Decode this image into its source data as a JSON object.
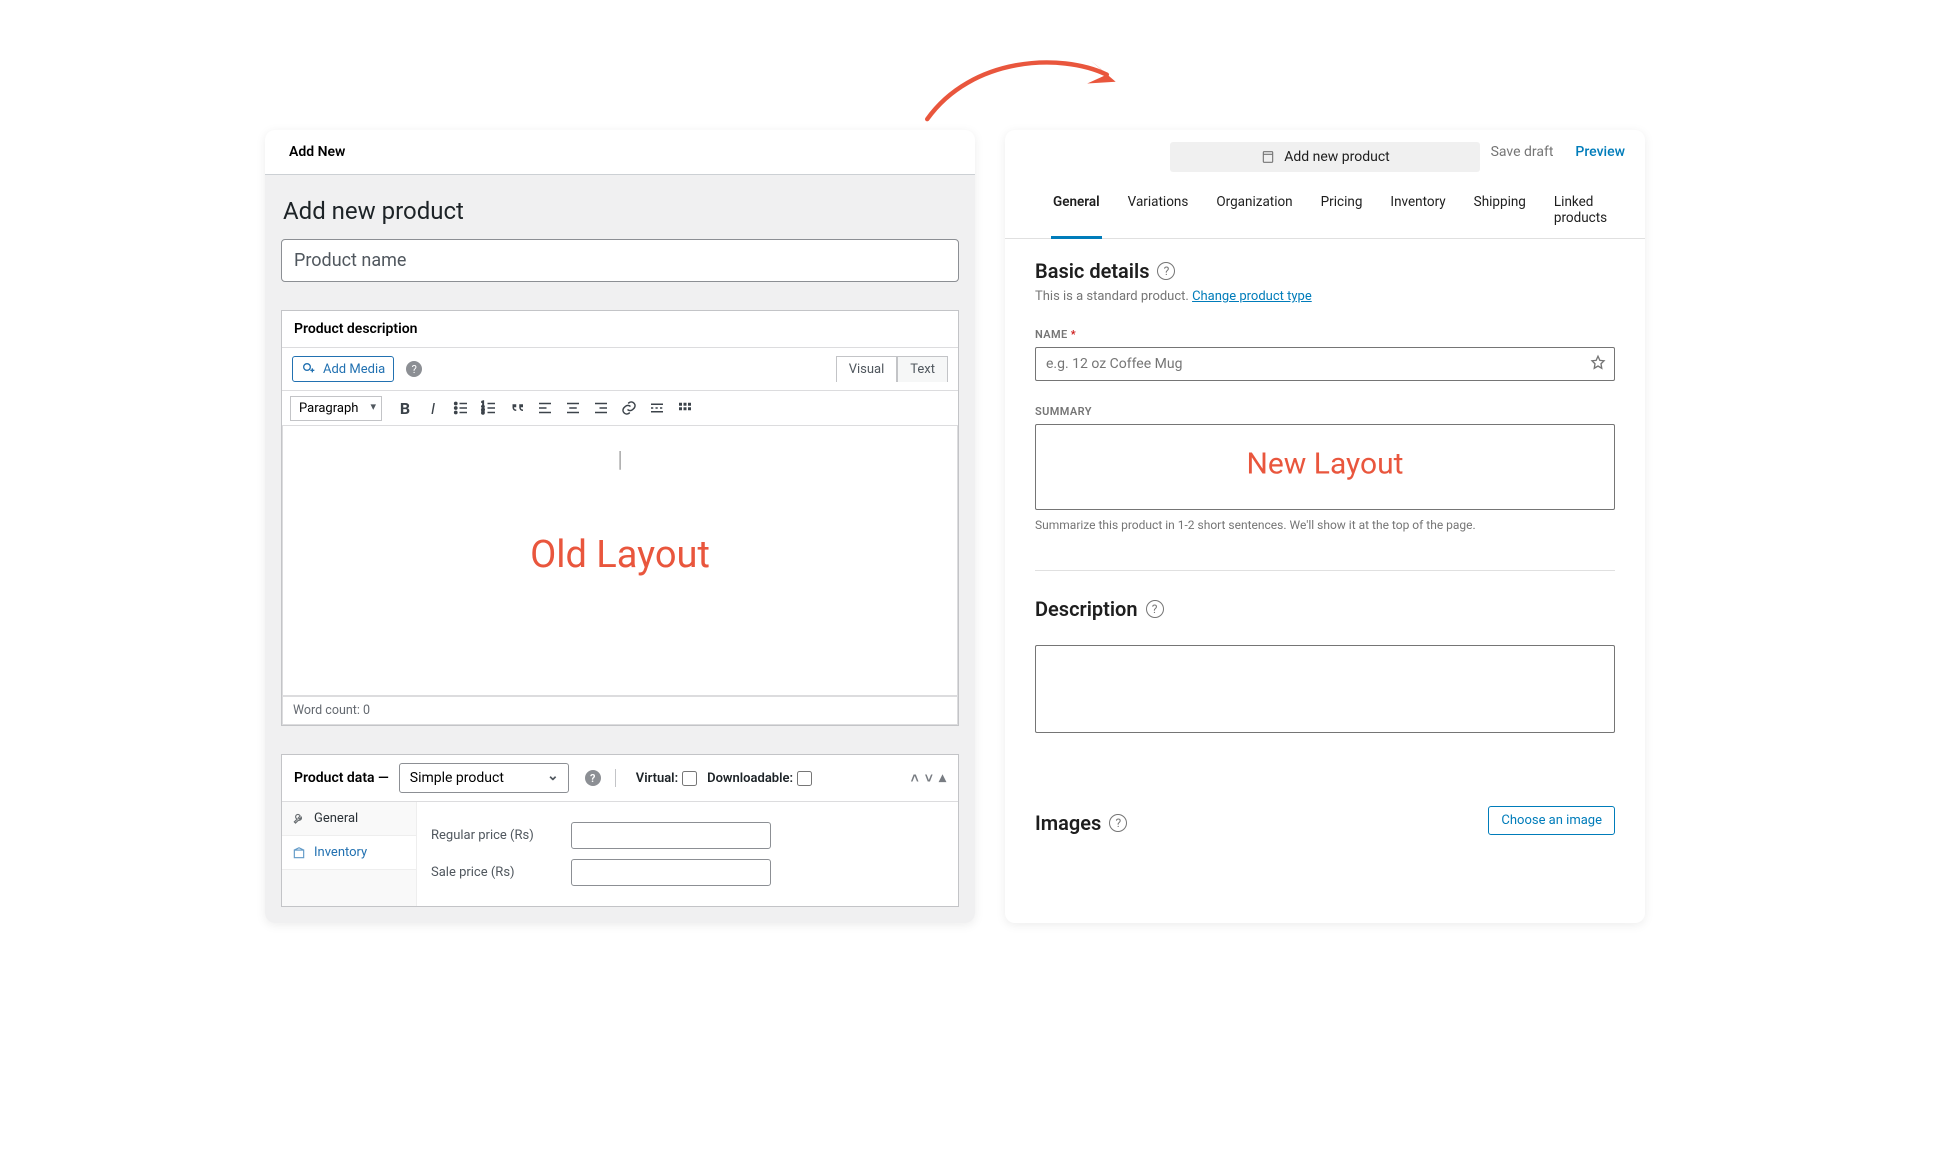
{
  "arrow_color": "#e9563d",
  "old": {
    "top_header": "Add New",
    "page_title": "Add new product",
    "name_placeholder": "Product name",
    "desc_heading": "Product description",
    "add_media_label": "Add Media",
    "editor_tabs": {
      "visual": "Visual",
      "text": "Text"
    },
    "paragraph_select": "Paragraph",
    "overlay": "Old Layout",
    "word_count": "Word count: 0",
    "product_data_label": "Product data —",
    "product_type": "Simple product",
    "virtual_label": "Virtual:",
    "downloadable_label": "Downloadable:",
    "tabs": {
      "general": "General",
      "inventory": "Inventory"
    },
    "regular_price_label": "Regular price (Rs)",
    "sale_price_label": "Sale price (Rs)"
  },
  "new": {
    "title_chip": "Add new product",
    "save_draft": "Save draft",
    "preview": "Preview",
    "tabs": [
      "General",
      "Variations",
      "Organization",
      "Pricing",
      "Inventory",
      "Shipping",
      "Linked products"
    ],
    "basic_title": "Basic details",
    "basic_sub_prefix": "This is a standard product. ",
    "change_link": "Change product type",
    "name_label": "NAME",
    "name_placeholder": "e.g. 12 oz Coffee Mug",
    "summary_label": "SUMMARY",
    "summary_helper": "Summarize this product in 1-2 short sentences. We'll show it at the top of the page.",
    "overlay": "New Layout",
    "description_title": "Description",
    "images_title": "Images",
    "choose_image": "Choose an image"
  }
}
